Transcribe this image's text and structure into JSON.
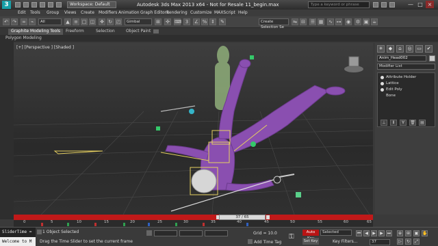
{
  "titlebar": {
    "logo": "3",
    "workspace": "Workspace: Default",
    "title": "Autodesk 3ds Max  2013 x64  - Not for Resale    11_begin.max",
    "search_placeholder": "Type a keyword or phrase",
    "win_min": "—",
    "win_max": "□",
    "win_close": "×"
  },
  "menu": [
    "Edit",
    "Tools",
    "Group",
    "Views",
    "Create",
    "Modifiers",
    "Animation",
    "Graph Editors",
    "Rendering",
    "Customize",
    "MAXScript",
    "Help"
  ],
  "toolbar": {
    "filter": "All",
    "coord": "Gimbal",
    "selection_set": "Create Selection Se"
  },
  "ribbon": {
    "tabs": [
      "Graphite Modeling Tools",
      "Freeform",
      "Selection",
      "Object Paint"
    ],
    "sub": "Polygon Modeling"
  },
  "viewport": {
    "label": "[+] [Perspective ] [Shaded ]"
  },
  "command_panel": {
    "object_name": "Anim_Head002",
    "modifier_list": "Modifier List",
    "stack": [
      "Attribute Holder",
      "Lattice",
      "Edit Poly",
      "Bone"
    ]
  },
  "timeline": {
    "current": "37 / 65",
    "ticks": [
      "0",
      "5",
      "10",
      "15",
      "20",
      "25",
      "30",
      "35",
      "40",
      "45",
      "50",
      "55",
      "60",
      "65"
    ]
  },
  "status": {
    "maxscript_label": "SliderTime =",
    "maxscript_output": "Welcome to M",
    "selection": "1 Object Selected",
    "prompt": "Drag the Time Slider to set the current frame",
    "grid": "Grid = 10.0",
    "add_time_tag": "Add Time Tag",
    "auto_key": "Auto Key",
    "set_key": "Set Key",
    "selected_dropdown": "Selected",
    "key_filters": "Key Filters...",
    "frame": "37"
  },
  "colors": {
    "accent": "#18a0a8",
    "time_slider": "#c11919",
    "character": "#8a4fb0",
    "bone_yellow": "#e6d060"
  }
}
